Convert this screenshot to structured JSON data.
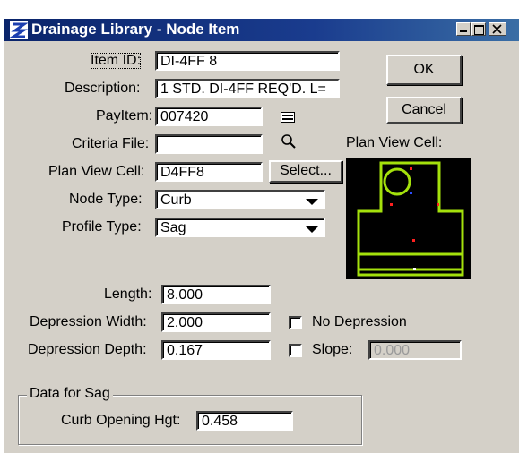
{
  "window": {
    "title": "Drainage Library - Node Item",
    "icon": "drainage-logo-icon",
    "controls": [
      "minimize-icon",
      "maximize-icon",
      "close-icon"
    ]
  },
  "form": {
    "item_id": {
      "label": "Item ID:",
      "value": "DI-4FF 8"
    },
    "description": {
      "label": "Description:",
      "value": "1 STD. DI-4FF REQ'D. L="
    },
    "pay_item": {
      "label": "PayItem:",
      "value": "007420",
      "icon": "list-icon"
    },
    "criteria_file": {
      "label": "Criteria File:",
      "value": "",
      "icon": "search-icon"
    },
    "plan_view_cell": {
      "label": "Plan View Cell:",
      "value": "D4FF8",
      "select_label": "Select..."
    },
    "node_type": {
      "label": "Node Type:",
      "value": "Curb"
    },
    "profile_type": {
      "label": "Profile Type:",
      "value": "Sag"
    },
    "length": {
      "label": "Length:",
      "value": "8.000"
    },
    "depression_width": {
      "label": "Depression Width:",
      "value": "2.000"
    },
    "depression_depth": {
      "label": "Depression Depth:",
      "value": "0.167"
    },
    "no_depression": {
      "label": "No Depression",
      "checked": false
    },
    "slope": {
      "label": "Slope:",
      "value": "0.000",
      "checked": false,
      "disabled": true
    }
  },
  "buttons": {
    "ok": "OK",
    "cancel": "Cancel"
  },
  "preview": {
    "label": "Plan View Cell:",
    "colors": {
      "background": "#000000",
      "outline": "#a4e10c",
      "marker": "#ff2020",
      "accent": "#2b4dff"
    }
  },
  "sag_group": {
    "title": "Data for Sag",
    "curb_opening_hgt": {
      "label": "Curb Opening Hgt:",
      "value": "0.458"
    }
  }
}
